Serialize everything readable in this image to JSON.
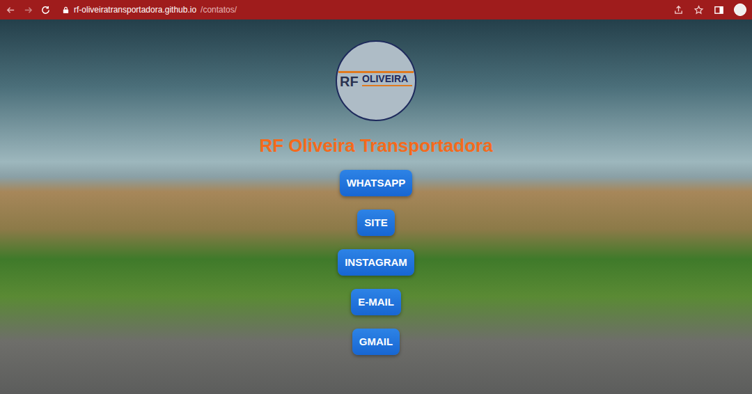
{
  "browser": {
    "url_host": "rf-oliveiratransportadora.github.io",
    "url_path": "/contatos/"
  },
  "page": {
    "logo": {
      "initials": "RF",
      "name": "OLIVEIRA"
    },
    "title": "RF Oliveira Transportadora",
    "buttons": [
      {
        "label": "WHATSAPP"
      },
      {
        "label": "SITE"
      },
      {
        "label": "INSTAGRAM"
      },
      {
        "label": "E-MAIL"
      },
      {
        "label": "GMAIL"
      }
    ]
  }
}
